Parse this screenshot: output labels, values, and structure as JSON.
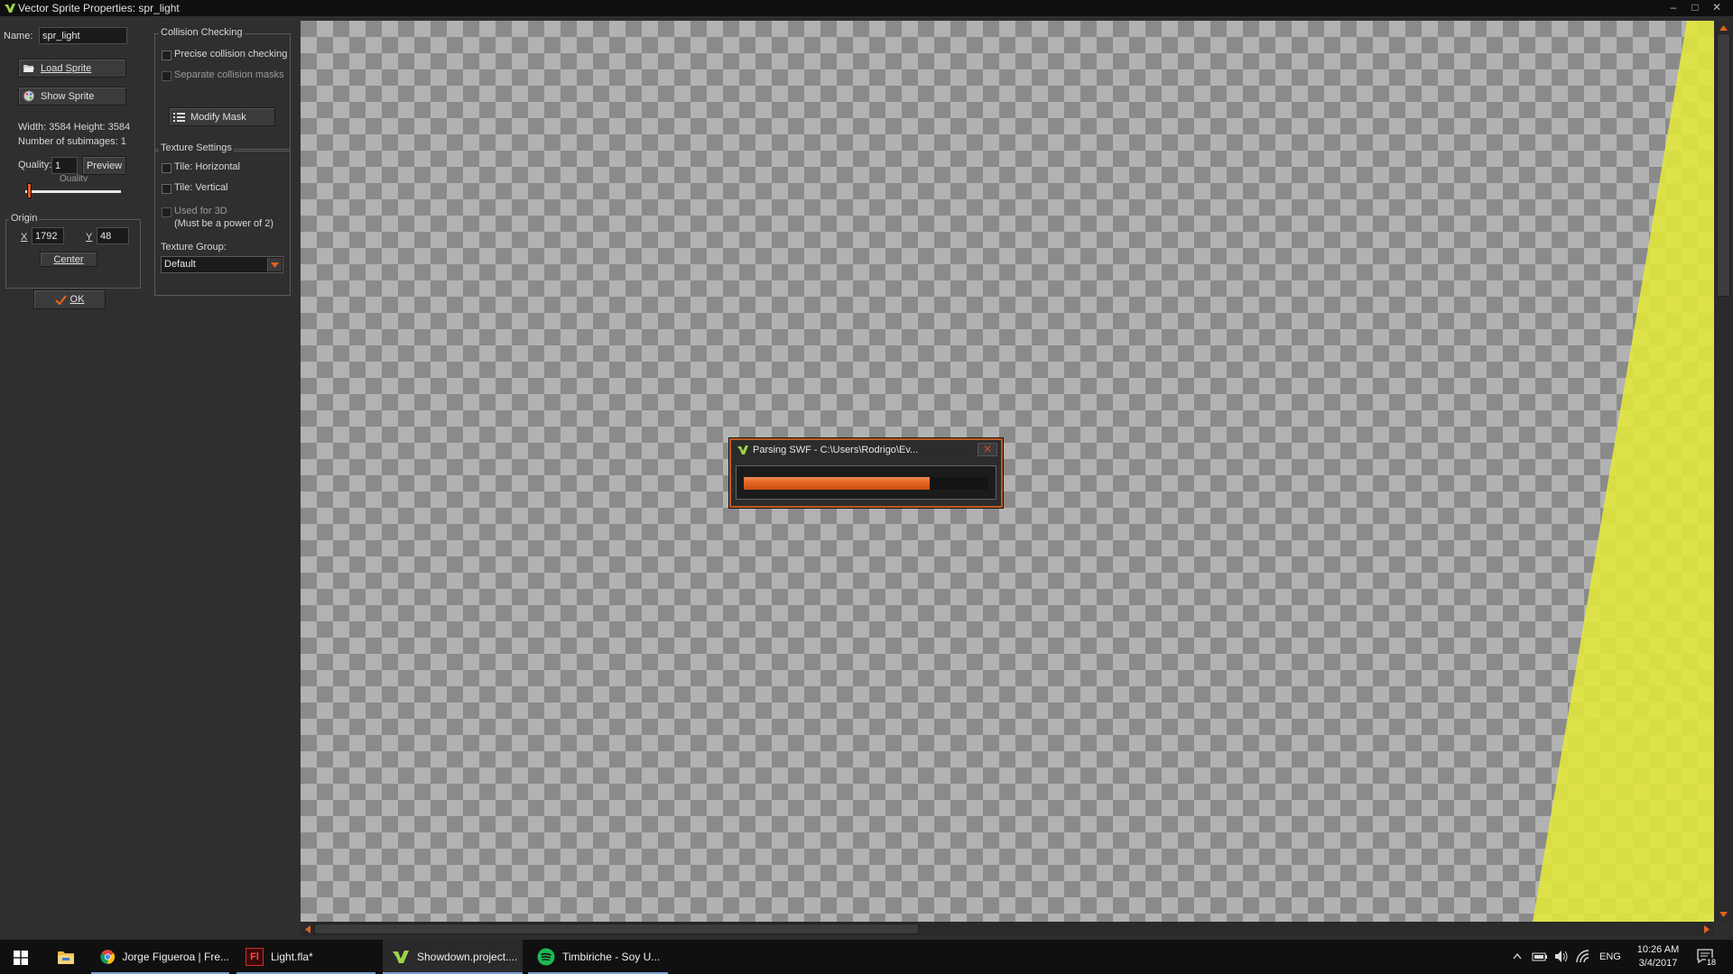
{
  "window": {
    "title": "Vector Sprite Properties: spr_light",
    "controls": [
      "–",
      "□",
      "✕"
    ]
  },
  "sprite": {
    "name_label": "Name:",
    "name_value": "spr_light",
    "load_label": "Load Sprite",
    "show_label": "Show Sprite",
    "size_text": "Width: 3584  Height: 3584",
    "subimages_text": "Number of subimages: 1",
    "quality_label": "Quality:",
    "quality_value": "1",
    "preview_label": "Preview",
    "quality_caption": "Quality",
    "quality_slider_fraction": 0.02
  },
  "origin": {
    "title": "Origin",
    "x_label": "X",
    "x_value": "1792",
    "y_label": "Y",
    "y_value": "48",
    "center_label": "Center"
  },
  "ok_label": "OK",
  "collision": {
    "title": "Collision Checking",
    "precise_label": "Precise collision checking",
    "separate_label": "Separate collision masks",
    "modify_label": "Modify Mask"
  },
  "texture": {
    "title": "Texture Settings",
    "tile_h_label": "Tile: Horizontal",
    "tile_v_label": "Tile: Vertical",
    "used3d_label": "Used for 3D",
    "power2_label": "(Must be a power of 2)",
    "group_label": "Texture Group:",
    "group_value": "Default"
  },
  "dialog": {
    "title": "Parsing SWF - C:\\Users\\Rodrigo\\Ev...",
    "close_glyph": "✕",
    "progress": 0.76
  },
  "taskbar": {
    "items": [
      {
        "label": "Jorge Figueroa | Fre...",
        "icon": "chrome-icon"
      },
      {
        "label": "Light.fla*",
        "icon": "flash-icon",
        "icon_text": "Fl"
      },
      {
        "label": "Showdown.project....",
        "icon": "gamemaker-icon"
      },
      {
        "label": "Timbiriche - Soy U...",
        "icon": "spotify-icon"
      }
    ],
    "language": "ENG",
    "time": "10:26 AM",
    "date": "3/4/2017",
    "notifications": "18"
  },
  "colors": {
    "accent_orange": "#e0621f",
    "sprite_yellow": "#e4e83a",
    "panel_bg": "#2f2f2f"
  }
}
